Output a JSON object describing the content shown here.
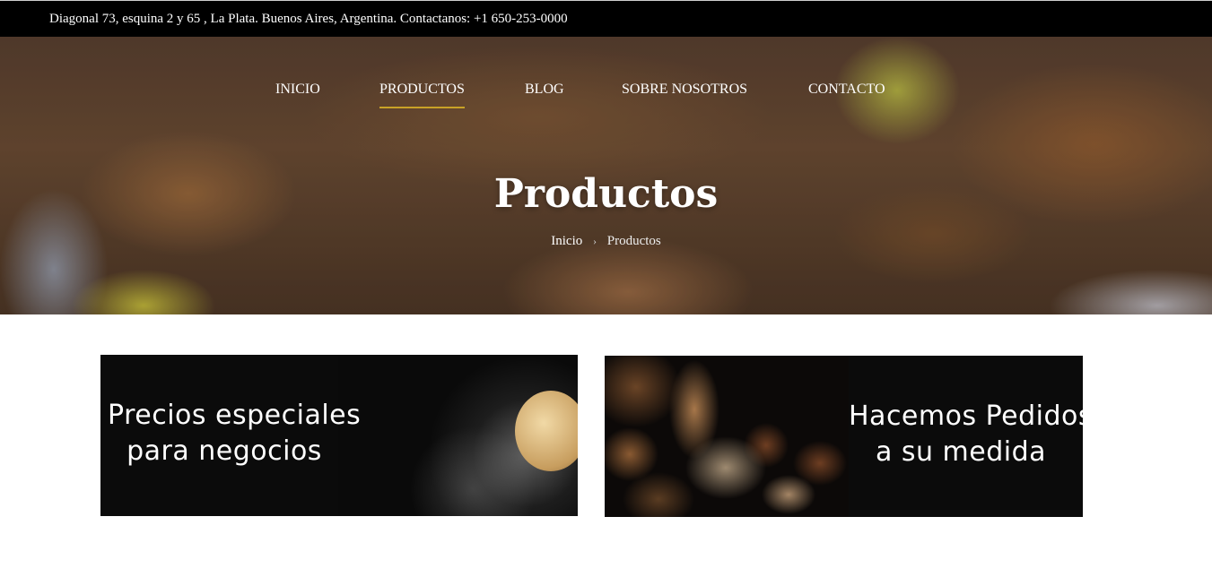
{
  "topbar": {
    "contact": "Diagonal 73, esquina 2 y 65 , La Plata. Buenos Aires, Argentina. Contactanos: +1 650-253-0000"
  },
  "nav": {
    "items": [
      {
        "label": "INICIO",
        "active": false
      },
      {
        "label": "PRODUCTOS",
        "active": true
      },
      {
        "label": "BLOG",
        "active": false
      },
      {
        "label": "SOBRE NOSOTROS",
        "active": false
      },
      {
        "label": "CONTACTO",
        "active": false
      }
    ]
  },
  "hero": {
    "title": "Productos",
    "breadcrumb": {
      "home": "Inicio",
      "separator": "›",
      "current": "Productos"
    }
  },
  "banners": [
    {
      "line1": "Precios especiales",
      "line2": "para negocios"
    },
    {
      "line1": "Hacemos Pedidos",
      "line2": "a su medida"
    }
  ],
  "colors": {
    "accent": "#c9a227",
    "topbar_bg": "#000000",
    "banner_bg": "#0b0b0b"
  }
}
